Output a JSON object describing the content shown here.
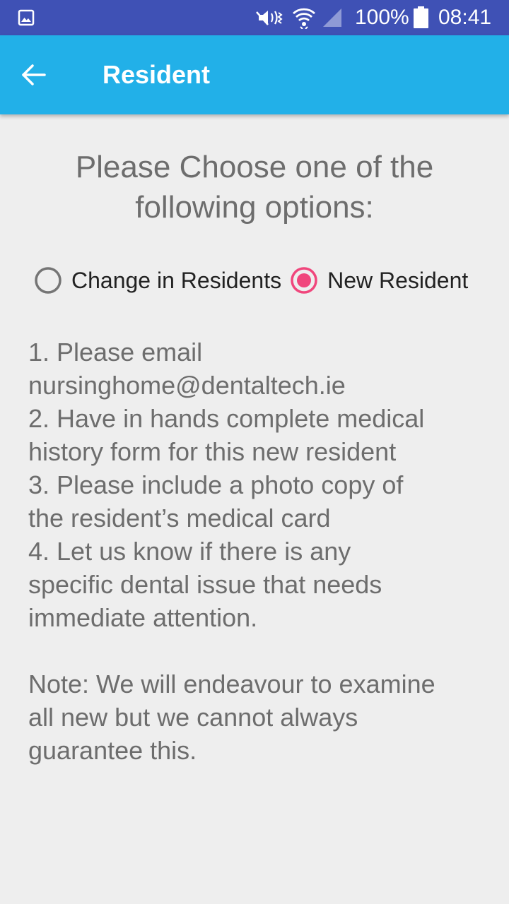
{
  "status_bar": {
    "battery_percent": "100%",
    "time": "08:41",
    "icons": [
      "gallery-icon",
      "mute-icon",
      "wifi-icon",
      "signal-icon",
      "battery-icon"
    ]
  },
  "app_bar": {
    "title": "Resident",
    "back_icon": "arrow-left-icon"
  },
  "heading": {
    "line1": "Please Choose one of the",
    "line2": "following options:"
  },
  "options": [
    {
      "label": "Change in Residents",
      "selected": false
    },
    {
      "label": "New Resident",
      "selected": true
    }
  ],
  "instructions": {
    "lines": [
      "1. Please email",
      "nursinghome@dentaltech.ie",
      "2. Have in hands complete medical",
      "history form for this new resident",
      "3. Please include a photo copy of",
      "the resident’s medical card",
      "4. Let us know if there is any",
      "specific dental issue that needs",
      "immediate attention."
    ],
    "note_lines": [
      "Note: We will endeavour to examine",
      "all new but we cannot always",
      "guarantee this."
    ]
  },
  "colors": {
    "status_bar": "#3f51b5",
    "app_bar": "#22b0e8",
    "background": "#eeeeee",
    "accent": "#f0467c",
    "text_gray": "#6d6d6d"
  }
}
